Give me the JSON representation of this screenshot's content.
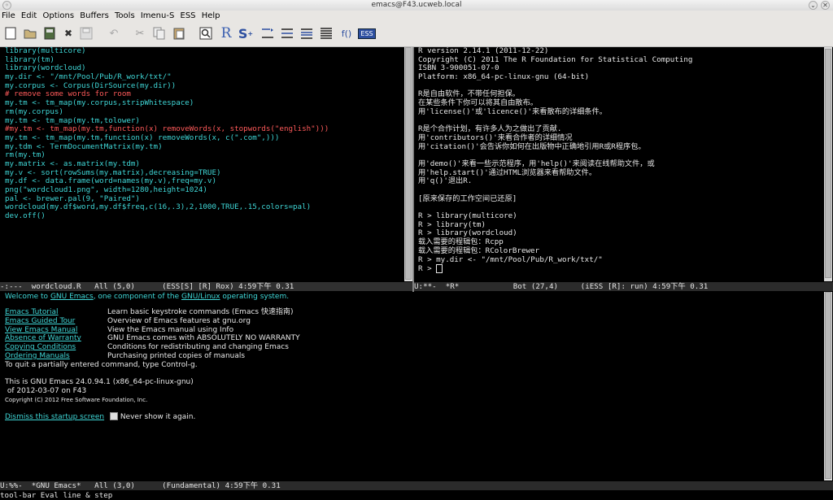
{
  "window": {
    "title": "emacs@F43.ucweb.local"
  },
  "menu": [
    "File",
    "Edit",
    "Options",
    "Buffers",
    "Tools",
    "Imenu-S",
    "ESS",
    "Help"
  ],
  "toolbar": {
    "icons": [
      "new-file-icon",
      "open-folder-icon",
      "save-icon",
      "close-icon",
      "disk-icon",
      "undo-icon",
      "cut-icon",
      "copy-icon",
      "paste-icon",
      "search-icon",
      "r-icon",
      "s-icon",
      "eval-line-icon",
      "eval-region-icon",
      "eval-function-icon",
      "eval-buffer-icon",
      "eval-file-icon",
      "ess-icon"
    ],
    "glyphs": [
      "▢",
      "📂",
      "▤",
      "✖",
      "▣",
      "↶",
      "✂",
      "⧉",
      "📋",
      "🔍",
      "R",
      "S",
      "⇥",
      "⇶",
      "⇶",
      "☰",
      "f()",
      "ESS"
    ]
  },
  "left_pane": {
    "lines": [
      "library(multicore)",
      "library(tm)",
      "library(wordcloud)",
      "my.dir <- \"/mnt/Pool/Pub/R_work/txt/\"",
      "my.corpus <- Corpus(DirSource(my.dir))",
      "# remove some words for room",
      "my.tm <- tm_map(my.corpus,stripWhitespace)",
      "rm(my.corpus)",
      "my.tm <- tm_map(my.tm,tolower)",
      "#my.tm <- tm_map(my.tm,function(x) removeWords(x, stopwords(\"english\")))",
      "my.tm <- tm_map(my.tm,function(x) removeWords(x, c(\".com\",)))",
      "my.tdm <- TermDocumentMatrix(my.tm)",
      "rm(my.tm)",
      "my.matrix <- as.matrix(my.tdm)",
      "my.v <- sort(rowSums(my.matrix),decreasing=TRUE)",
      "my.df <- data.frame(word=names(my.v),freq=my.v)",
      "png(\"wordcloud1.png\", width=1280,height=1024)",
      "pal <- brewer.pal(9, \"Paired\")",
      "wordcloud(my.df$word,my.df$freq,c(16,.3),2,1000,TRUE,.15,colors=pal)",
      "dev.off()"
    ],
    "modeline": "-:---  wordcloud.R   All (5,0)      (ESS[S] [R] Rox) 4:59下午 0.31"
  },
  "right_pane": {
    "lines": [
      "R version 2.14.1 (2011-12-22)",
      "Copyright (C) 2011 The R Foundation for Statistical Computing",
      "ISBN 3-900051-07-0",
      "Platform: x86_64-pc-linux-gnu (64-bit)",
      "",
      "R是自由软件，不带任何担保。",
      "在某些条件下你可以将其自由散布。",
      "用'license()'或'licence()'来看散布的详细条件。",
      "",
      "R是个合作计划，有许多人为之做出了贡献.",
      "用'contributors()'来看合作者的详细情况",
      "用'citation()'会告诉你如何在出版物中正确地引用R或R程序包。",
      "",
      "用'demo()'来看一些示范程序，用'help()'来阅读在线帮助文件，或",
      "用'help.start()'通过HTML浏览器来看帮助文件。",
      "用'q()'退出R.",
      "",
      "[原来保存的工作空间已还原]",
      "",
      "R > library(multicore)",
      "R > library(tm)",
      "R > library(wordcloud)",
      "载入需要的程辑包：Rcpp",
      "载入需要的程辑包：RColorBrewer",
      "R > my.dir <- \"/mnt/Pool/Pub/R_work/txt/\"",
      "R > "
    ],
    "modeline": "U:**-  *R*            Bot (27,4)     (iESS [R]: run) 4:59下午 0.31"
  },
  "bottom_pane": {
    "welcome": {
      "pre": "Welcome to ",
      "link1": "GNU Emacs",
      "mid": ", one component of the ",
      "link2": "GNU/Linux",
      "post": " operating system."
    },
    "links": [
      {
        "label": "Emacs Tutorial",
        "desc": "Learn basic keystroke commands (Emacs 快速指南)"
      },
      {
        "label": "Emacs Guided Tour",
        "desc": "Overview of Emacs features at gnu.org"
      },
      {
        "label": "View Emacs Manual",
        "desc": "View the Emacs manual using Info"
      },
      {
        "label": "Absence of Warranty",
        "desc": "GNU Emacs comes with ABSOLUTELY NO WARRANTY"
      },
      {
        "label": "Copying Conditions",
        "desc": "Conditions for redistributing and changing Emacs"
      },
      {
        "label": "Ordering Manuals",
        "desc": "Purchasing printed copies of manuals"
      }
    ],
    "quit_hint": "To quit a partially entered command, type Control-g.",
    "version_line1": "This is GNU Emacs 24.0.94.1 (x86_64-pc-linux-gnu)",
    "version_line2": " of 2012-03-07 on F43",
    "copyright": "Copyright (C) 2012 Free Software Foundation, Inc.",
    "dismiss": "Dismiss this startup screen",
    "never_show": "Never show it again.",
    "modeline": "U:%%-  *GNU Emacs*   All (3,0)      (Fundamental) 4:59下午 0.31"
  },
  "echo_area": "tool-bar Eval line & step"
}
